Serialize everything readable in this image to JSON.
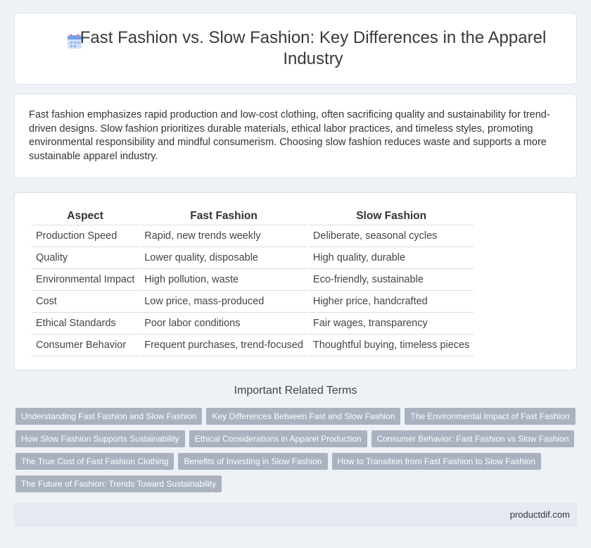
{
  "header": {
    "title": "Fast Fashion vs. Slow Fashion: Key Differences in the Apparel Industry",
    "icon": "calendar-icon"
  },
  "summary": {
    "text": "Fast fashion emphasizes rapid production and low-cost clothing, often sacrificing quality and sustainability for trend-driven designs. Slow fashion prioritizes durable materials, ethical labor practices, and timeless styles, promoting environmental responsibility and mindful consumerism. Choosing slow fashion reduces waste and supports a more sustainable apparel industry."
  },
  "table": {
    "headers": [
      "Aspect",
      "Fast Fashion",
      "Slow Fashion"
    ],
    "rows": [
      [
        "Production Speed",
        "Rapid, new trends weekly",
        "Deliberate, seasonal cycles"
      ],
      [
        "Quality",
        "Lower quality, disposable",
        "High quality, durable"
      ],
      [
        "Environmental Impact",
        "High pollution, waste",
        "Eco-friendly, sustainable"
      ],
      [
        "Cost",
        "Low price, mass-produced",
        "Higher price, handcrafted"
      ],
      [
        "Ethical Standards",
        "Poor labor conditions",
        "Fair wages, transparency"
      ],
      [
        "Consumer Behavior",
        "Frequent purchases, trend-focused",
        "Thoughtful buying, timeless pieces"
      ]
    ]
  },
  "related": {
    "title": "Important Related Terms",
    "tags": [
      "Understanding Fast Fashion and Slow Fashion",
      "Key Differences Between Fast and Slow Fashion",
      "The Environmental Impact of Fast Fashion",
      "How Slow Fashion Supports Sustainability",
      "Ethical Considerations in Apparel Production",
      "Consumer Behavior: Fast Fashion vs Slow Fashion",
      "The True Cost of Fast Fashion Clothing",
      "Benefits of Investing in Slow Fashion",
      "How to Transition from Fast Fashion to Slow Fashion",
      "The Future of Fashion: Trends Toward Sustainability"
    ]
  },
  "footer": {
    "site": "productdif.com"
  },
  "colors": {
    "background": "#eef1f6",
    "tag": "#aab2c0",
    "footer": "#e4e9f2"
  }
}
